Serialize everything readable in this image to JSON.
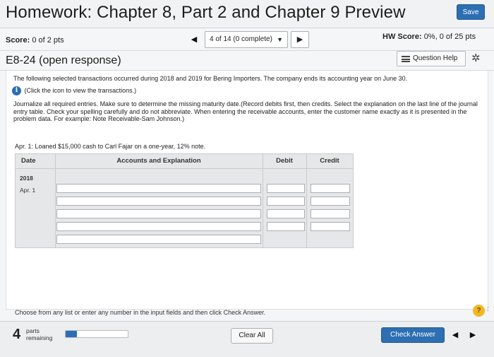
{
  "header": {
    "title": "Homework: Chapter 8, Part 2 and Chapter 9 Preview",
    "save_label": "Save"
  },
  "scorebar": {
    "score_label": "Score:",
    "score_value": "0 of 2 pts",
    "nav_position": "4 of 14 (0 complete)",
    "hw_score_label": "HW Score:",
    "hw_score_value": "0%, 0 of 25 pts"
  },
  "question": {
    "title": "E8-24 (open response)",
    "help_label": "Question Help"
  },
  "content": {
    "intro": "The following selected transactions occurred during 2018 and 2019 for Bering Importers. The company ends its accounting year on June 30.",
    "info_link": "(Click the icon to view the transactions.)",
    "instructions": "Journalize all required entries. Make sure to determine the missing maturity date.(Record debits first, then credits. Select the explanation on the last line of the journal entry table. Check your spelling carefully and do not abbreviate. When entering the receivable accounts, enter the customer name exactly as it is presented in the problem data. For example: Note Receivable-Sam Johnson.)",
    "transaction": "Apr. 1: Loaned $15,000 cash to Carl Fajar on a one-year, 12% note.",
    "prompt": "Choose from any list or enter any number in the input fields and then click Check Answer."
  },
  "journal": {
    "headers": {
      "date": "Date",
      "account": "Accounts and Explanation",
      "debit": "Debit",
      "credit": "Credit"
    },
    "year": "2018",
    "row_date": "Apr. 1"
  },
  "footer": {
    "parts_number": "4",
    "parts_label_1": "parts",
    "parts_label_2": "remaining",
    "progress_fraction": 0.18,
    "clear_label": "Clear All",
    "check_label": "Check Answer"
  },
  "icons": {
    "prev": "◀",
    "next": "▶",
    "caret": "▼",
    "gear": "✲",
    "info": "i",
    "help": "?"
  },
  "colors": {
    "accent": "#2c6fb3",
    "help_badge": "#f2b824"
  }
}
